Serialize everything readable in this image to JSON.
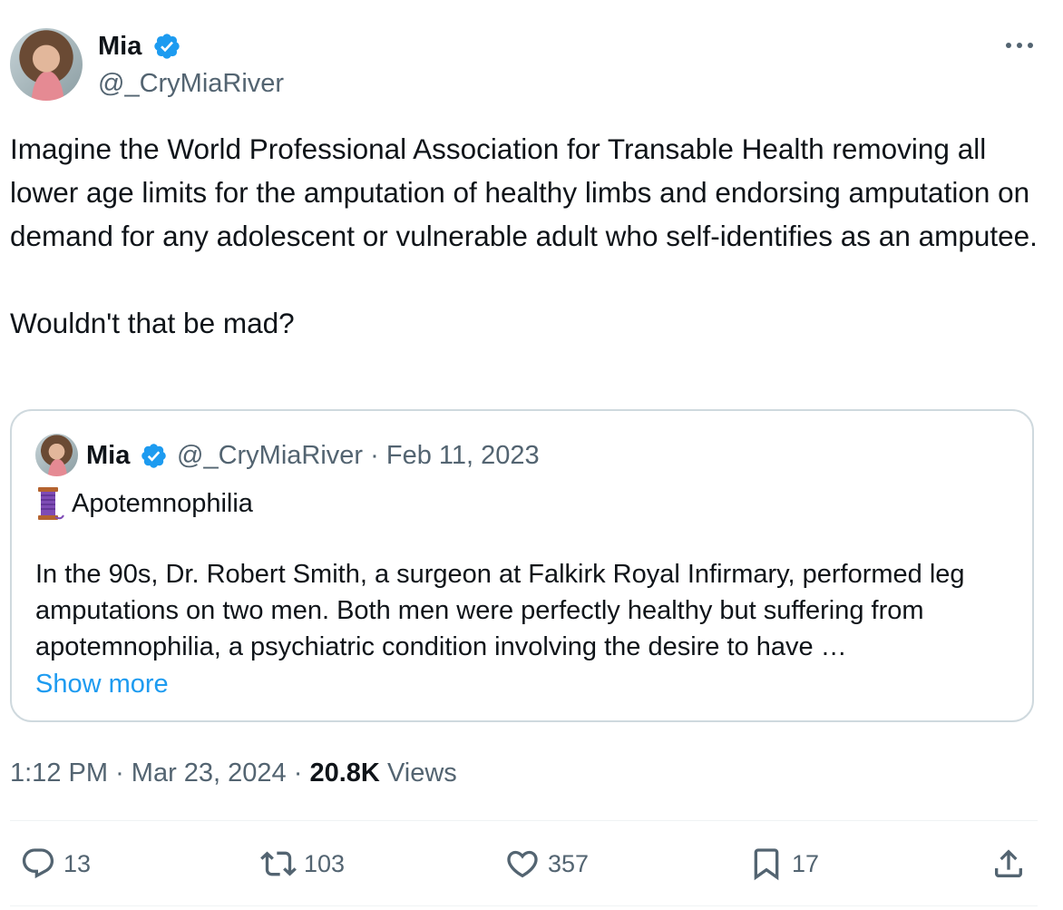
{
  "author": {
    "name": "Mia",
    "handle": "@_CryMiaRiver"
  },
  "tweet": {
    "text": "Imagine the World Professional Association for Transable Health removing all lower age limits for the amputation of healthy limbs and endorsing amputation on demand for any adolescent or vulnerable adult who self-identifies as an amputee.\n\nWouldn't that be mad?"
  },
  "quote": {
    "name": "Mia",
    "handle": "@_CryMiaRiver",
    "separator": "·",
    "date": "Feb 11, 2023",
    "title": "Apotemnophilia",
    "text": "In the 90s, Dr. Robert Smith, a surgeon at Falkirk Royal Infirmary, performed leg amputations on two men. Both men were perfectly healthy but suffering from apotemnophilia, a psychiatric condition involving the desire to have …",
    "show_more": "Show more"
  },
  "meta": {
    "time": "1:12 PM",
    "separator": "·",
    "date": "Mar 23, 2024",
    "views_count": "20.8K",
    "views_label": "Views"
  },
  "actions": {
    "replies": "13",
    "reposts": "103",
    "likes": "357",
    "bookmarks": "17"
  },
  "colors": {
    "text": "#0f1419",
    "secondary": "#536471",
    "link": "#1d9bf0",
    "verified": "#1d9bf0",
    "border": "#cfd9de"
  },
  "icons": [
    "verified-badge-icon",
    "more-icon",
    "spool-emoji-icon",
    "reply-icon",
    "repost-icon",
    "like-icon",
    "bookmark-icon",
    "share-icon"
  ]
}
